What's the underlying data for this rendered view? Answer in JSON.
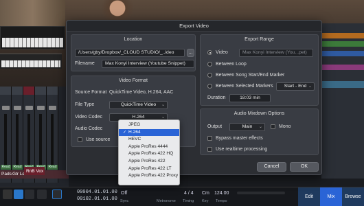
{
  "dialog": {
    "title": "Export Video",
    "location": {
      "header": "Location",
      "path": "/Users/gby/Dropbox/_CLOUD STUDIO/_..ideo",
      "browse_label": "...",
      "filename_label": "Filename",
      "filename": "Max Konyi Interview (Youtube Snippet)"
    },
    "export_range": {
      "header": "Export Range",
      "video_label": "Video",
      "video_value": "Max Konyi Interview (You...pet)",
      "between_loop": "Between Loop",
      "between_song": "Between Song Start/End Marker",
      "between_selected": "Between Selected Markers",
      "markers_value": "Start - End",
      "duration_label": "Duration",
      "duration_value": "18:03 min"
    },
    "video_format": {
      "header": "Video Format",
      "source_label": "Source Format",
      "source_value": "QuickTime Video, H.264, AAC",
      "filetype_label": "File Type",
      "filetype_value": "QuickTime Video",
      "vcodec_label": "Video Codec",
      "vcodec_value": "H.264",
      "acodec_label": "Audio Codec",
      "use_source": "Use source"
    },
    "audio_mixdown": {
      "header": "Audio Mixdown Options",
      "output_label": "Output",
      "output_value": "Main",
      "mono_label": "Mono",
      "bypass_label": "Bypass master effects",
      "realtime_label": "Use realtime processing"
    },
    "cancel_label": "Cancel",
    "ok_label": "OK"
  },
  "codec_menu": {
    "items": [
      "JPEG",
      "H.264",
      "HEVC",
      "Apple ProRes 4444",
      "Apple ProRes 422 HQ",
      "Apple ProRes 422",
      "Apple ProRes 422 LT",
      "Apple ProRes 422 Proxy"
    ],
    "selected": "H.264",
    "check": "✓"
  },
  "mixer": {
    "channel_labels": [
      "Pads",
      "Gtr Leads"
    ],
    "rnb_label": "RnB Vox",
    "read_labels": [
      "Read",
      "Read",
      "Read",
      "Read",
      "Read"
    ]
  },
  "transport": {
    "time1": "00004.01.01.00",
    "time2": "00102.01.01.00",
    "off_label": "Off",
    "sync_label": "Sync",
    "metronome_label": "Metronome",
    "timesig": "4 / 4",
    "timing_label": "Timing",
    "key_value": "Cm",
    "key_label": "Key",
    "tempo_value": "124.00",
    "tempo_label": "Tempo",
    "tabs": [
      "Edit",
      "Mix",
      "Browse"
    ]
  },
  "colors": {
    "accent": "#2a64d6",
    "dialog_bg": "#2c2e33"
  }
}
